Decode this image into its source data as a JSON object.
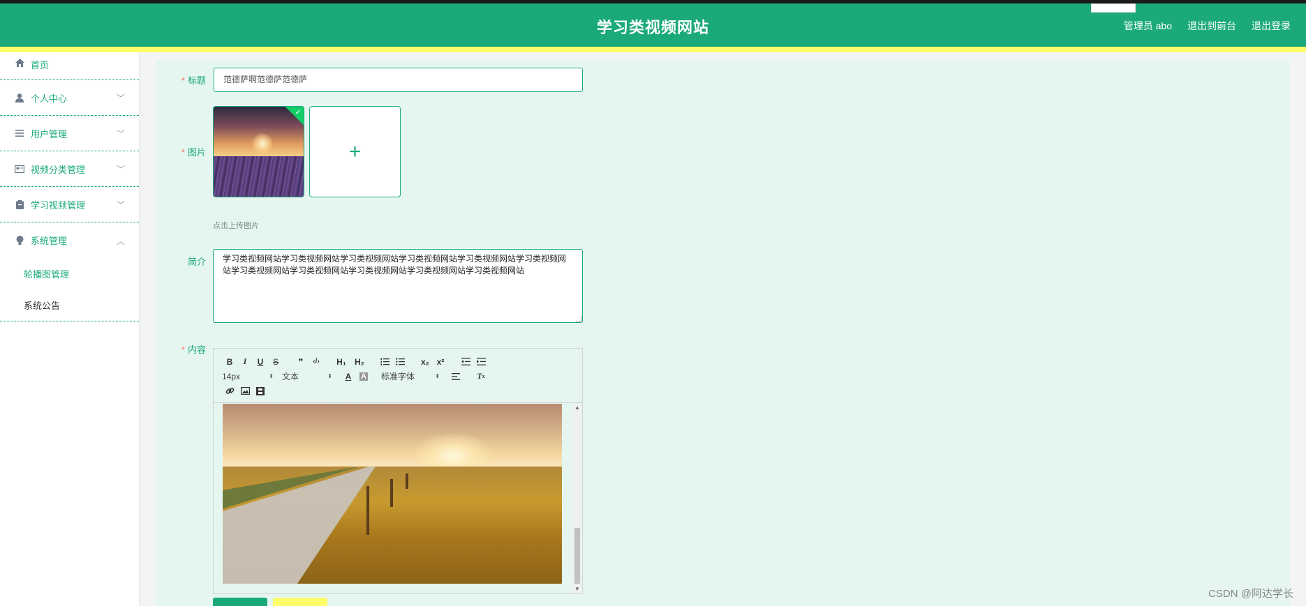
{
  "header": {
    "title": "学习类视频网站",
    "admin_label": "管理员 abo",
    "back_to_front": "退出到前台",
    "logout": "退出登录"
  },
  "sidebar": {
    "items": [
      {
        "label": "首页",
        "icon": "home-icon"
      },
      {
        "label": "个人中心",
        "icon": "user-icon"
      },
      {
        "label": "用户管理",
        "icon": "list-icon"
      },
      {
        "label": "视频分类管理",
        "icon": "card-icon"
      },
      {
        "label": "学习视频管理",
        "icon": "clipboard-icon"
      },
      {
        "label": "系统管理",
        "icon": "bulb-icon"
      }
    ],
    "sub_items": [
      {
        "label": "轮播图管理"
      },
      {
        "label": "系统公告"
      }
    ]
  },
  "form": {
    "title_label": "标题",
    "title_value": "范德萨啊范德萨范德萨",
    "image_label": "图片",
    "upload_hint": "点击上传图片",
    "intro_label": "简介",
    "intro_value": "学习类视频网站学习类视频网站学习类视频网站学习类视频网站学习类视频网站学习类视频网站学习类视频网站学习类视频网站学习类视频网站学习类视频网站学习类视频网站",
    "content_label": "内容",
    "required_mark": "*"
  },
  "editor": {
    "font_size": "14px",
    "format": "文本",
    "font_family": "标准字体",
    "buttons": {
      "bold": "B",
      "italic": "I",
      "underline": "U",
      "strike": "S",
      "quote": "❞",
      "code": "‹/›",
      "h1": "H₁",
      "h2": "H₂",
      "sub": "x₂",
      "sup": "x²"
    }
  },
  "watermark": "CSDN @阿达学长",
  "colors": {
    "primary": "#1ba97b",
    "accent_yellow": "#fdfd6b",
    "content_bg": "#e5f6f0"
  }
}
